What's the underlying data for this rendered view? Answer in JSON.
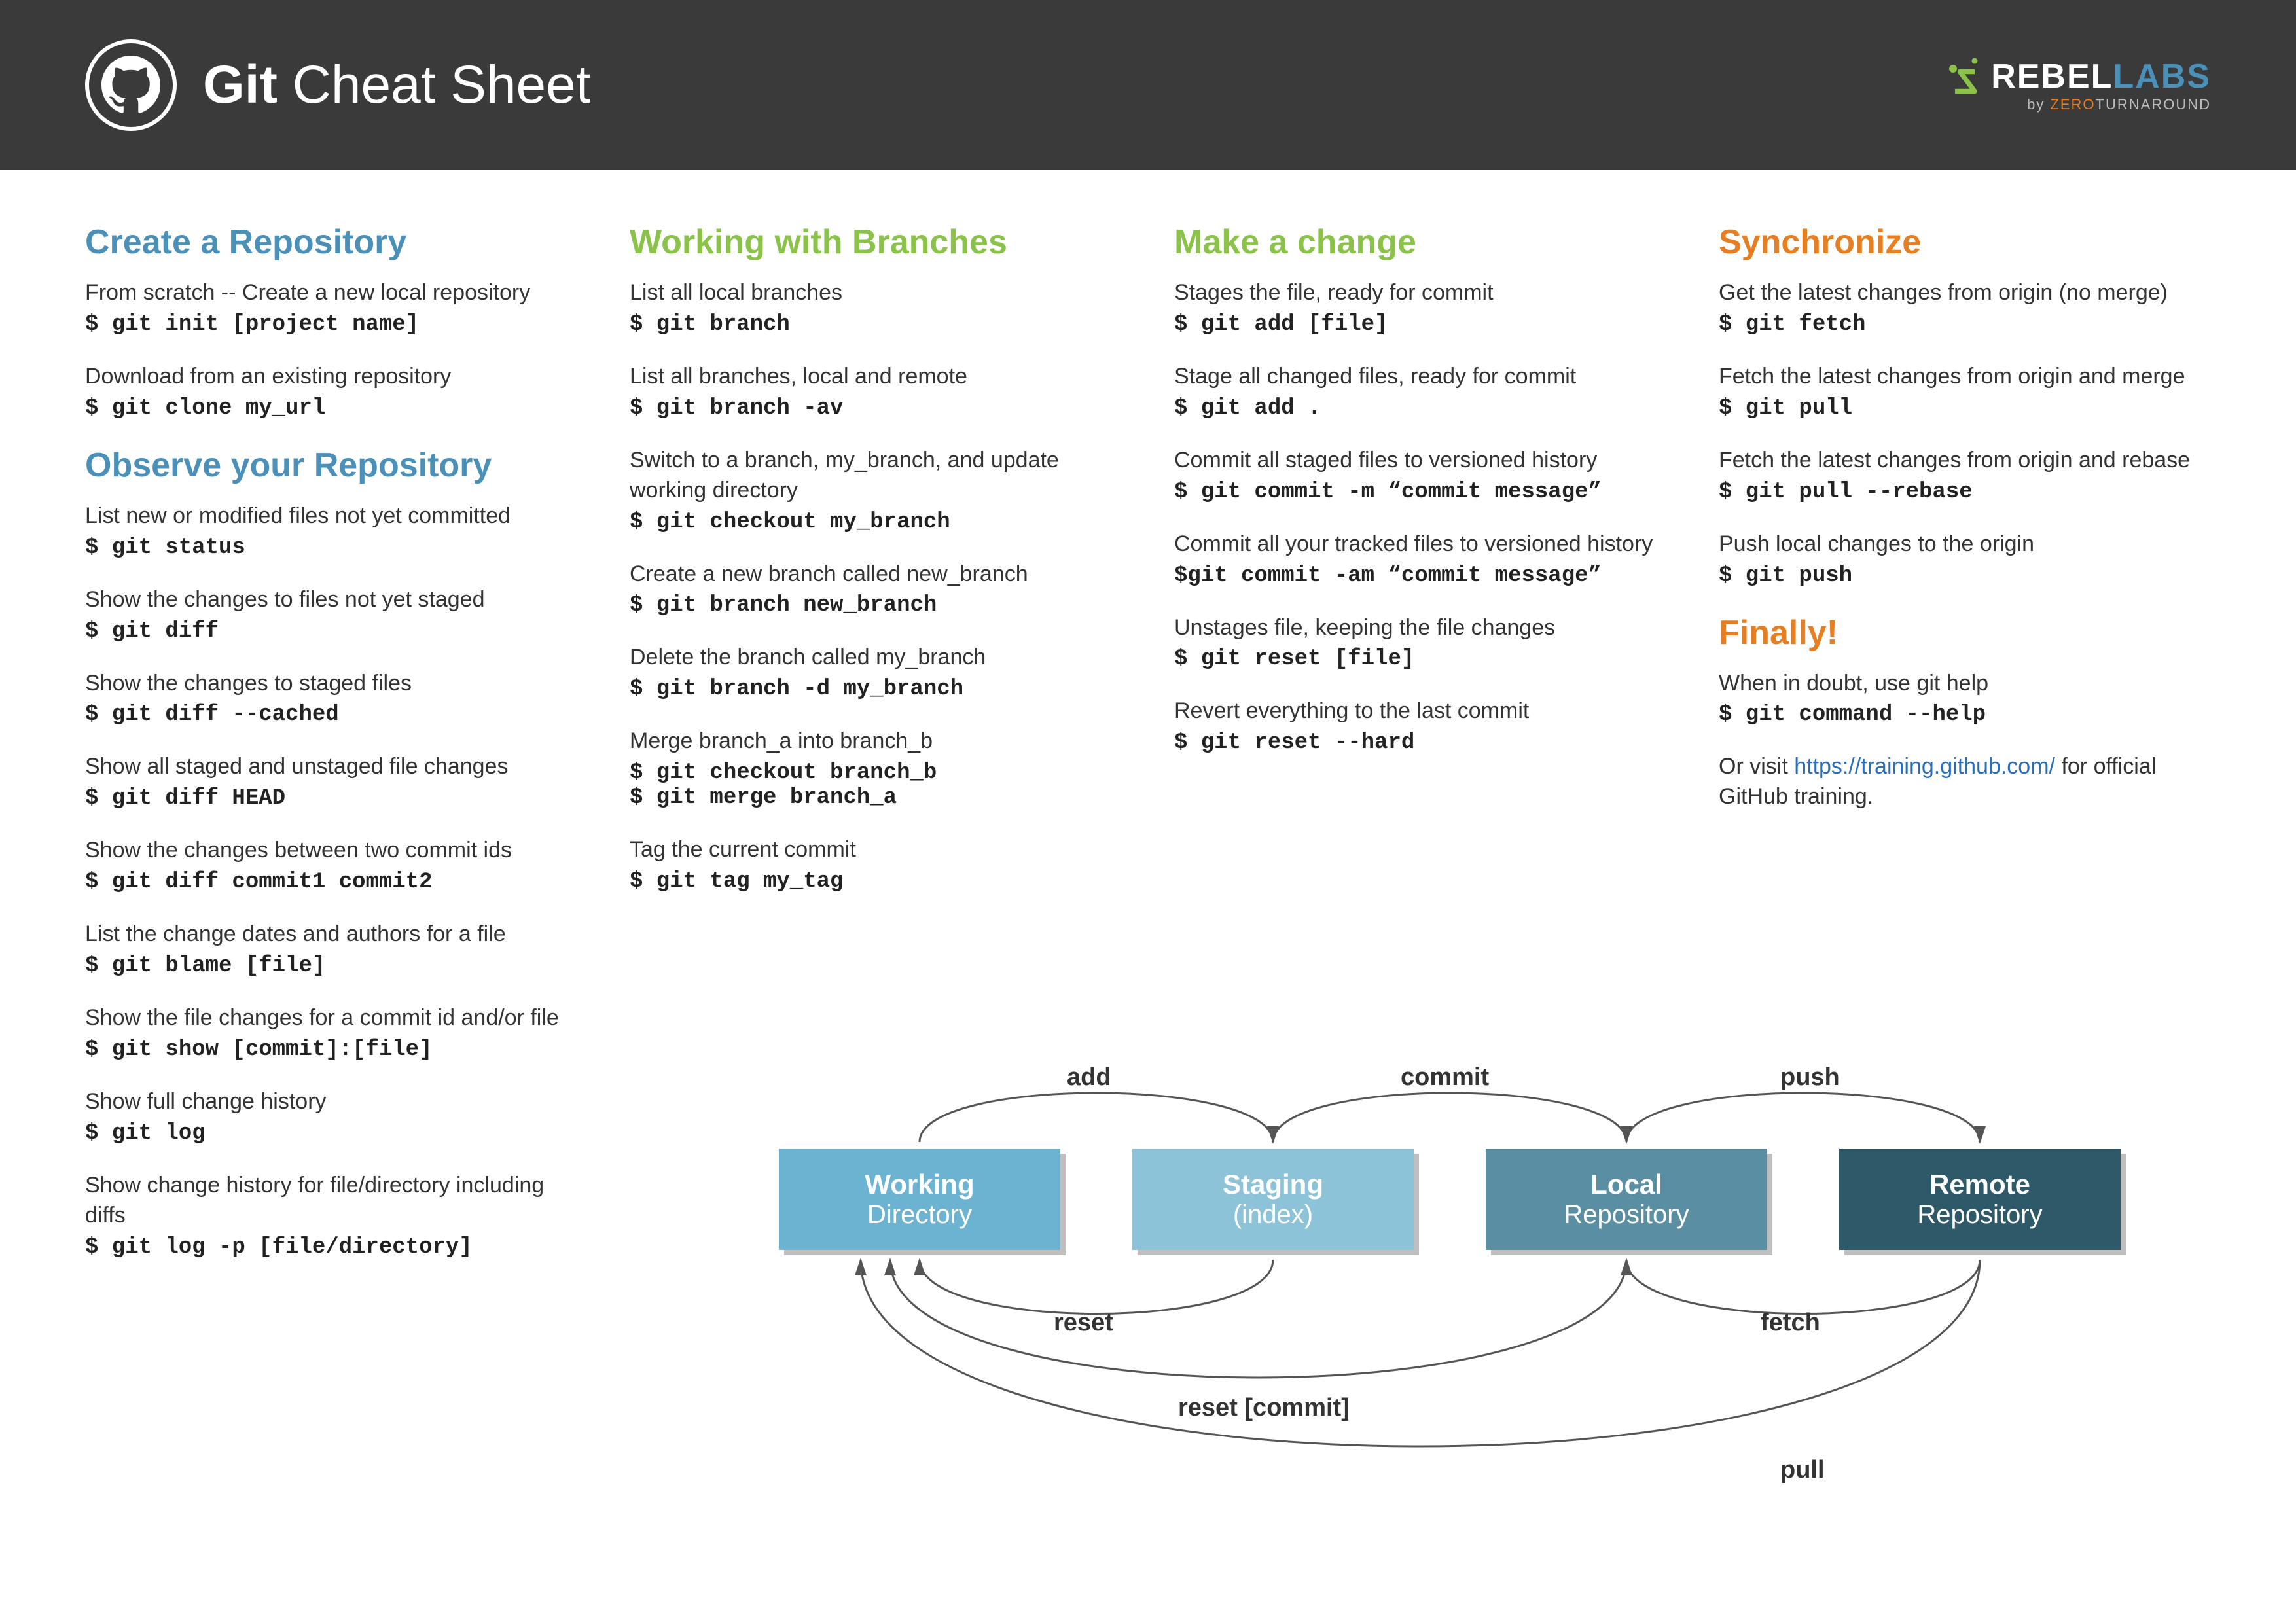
{
  "header": {
    "title_bold": "Git",
    "title_rest": " Cheat Sheet",
    "logo_rebel": "REBEL",
    "logo_labs": "LABS",
    "logo_by": "by ",
    "logo_zero": "ZERO",
    "logo_turn": "TURNAROUND"
  },
  "col1": {
    "s1_title": "Create a Repository",
    "s1_items": [
      {
        "desc": "From scratch -- Create a new local repository",
        "cmd": "$ git init [project name]"
      },
      {
        "desc": "Download from an existing repository",
        "cmd": "$ git clone my_url"
      }
    ],
    "s2_title": "Observe your Repository",
    "s2_items": [
      {
        "desc": "List new or modified files not yet committed",
        "cmd": "$ git status"
      },
      {
        "desc": "Show the changes to files not yet staged",
        "cmd": "$ git diff"
      },
      {
        "desc": "Show the changes to staged files",
        "cmd": "$ git diff --cached"
      },
      {
        "desc": "Show all staged and unstaged file changes",
        "cmd": "$ git diff HEAD"
      },
      {
        "desc": "Show the changes between two commit ids",
        "cmd": "$ git diff commit1 commit2"
      },
      {
        "desc": "List the change dates and authors for a file",
        "cmd": "$ git blame [file]"
      },
      {
        "desc": "Show the file changes for a commit id and/or file",
        "cmd": "$ git show [commit]:[file]"
      },
      {
        "desc": "Show full change history",
        "cmd": "$ git log"
      },
      {
        "desc": "Show change history for file/directory including diffs",
        "cmd": "$ git log -p [file/directory]"
      }
    ]
  },
  "col2": {
    "title": "Working with Branches",
    "items": [
      {
        "desc": "List all local branches",
        "cmd": "$ git branch"
      },
      {
        "desc": "List all branches, local and remote",
        "cmd": "$ git branch -av"
      },
      {
        "desc": "Switch to a branch, my_branch, and update working directory",
        "cmd": "$ git checkout my_branch"
      },
      {
        "desc": "Create a new branch called new_branch",
        "cmd": "$ git branch new_branch"
      },
      {
        "desc": "Delete the branch called my_branch",
        "cmd": "$ git branch -d my_branch"
      },
      {
        "desc": "Merge branch_a into branch_b",
        "cmd": "$ git checkout branch_b\n$ git merge branch_a"
      },
      {
        "desc": "Tag the current commit",
        "cmd": "$ git tag my_tag"
      }
    ]
  },
  "col3": {
    "title": "Make a change",
    "items": [
      {
        "desc": "Stages the file, ready for commit",
        "cmd": "$ git add [file]"
      },
      {
        "desc": "Stage all changed files, ready for commit",
        "cmd": "$ git add ."
      },
      {
        "desc": "Commit all staged files to versioned history",
        "cmd": "$ git commit -m “commit message”"
      },
      {
        "desc": "Commit all your tracked files to versioned history",
        "cmd": "$git commit -am “commit message”"
      },
      {
        "desc": "Unstages file, keeping the file changes",
        "cmd": "$ git reset [file]"
      },
      {
        "desc": "Revert everything to the last commit",
        "cmd": "$ git reset --hard"
      }
    ]
  },
  "col4": {
    "s1_title": "Synchronize",
    "s1_items": [
      {
        "desc": "Get the latest changes from origin (no merge)",
        "cmd": "$ git fetch"
      },
      {
        "desc": "Fetch the latest changes from origin and merge",
        "cmd": "$ git pull"
      },
      {
        "desc": "Fetch the latest changes from origin and rebase",
        "cmd": "$ git pull --rebase"
      },
      {
        "desc": "Push local changes to the origin",
        "cmd": "$ git push"
      }
    ],
    "s2_title": "Finally!",
    "s2_desc": "When in doubt, use git help",
    "s2_cmd": "$ git command --help",
    "s2_or": "Or visit ",
    "s2_link": "https://training.github.com/",
    "s2_tail": " for official GitHub training."
  },
  "diagram": {
    "b1_l1": "Working",
    "b1_l2": "Directory",
    "b2_l1": "Staging",
    "b2_l2": "(index)",
    "b3_l1": "Local",
    "b3_l2": "Repository",
    "b4_l1": "Remote",
    "b4_l2": "Repository",
    "add": "add",
    "commit": "commit",
    "push": "push",
    "reset": "reset",
    "fetch": "fetch",
    "reset_commit": "reset [commit]",
    "pull": "pull"
  }
}
